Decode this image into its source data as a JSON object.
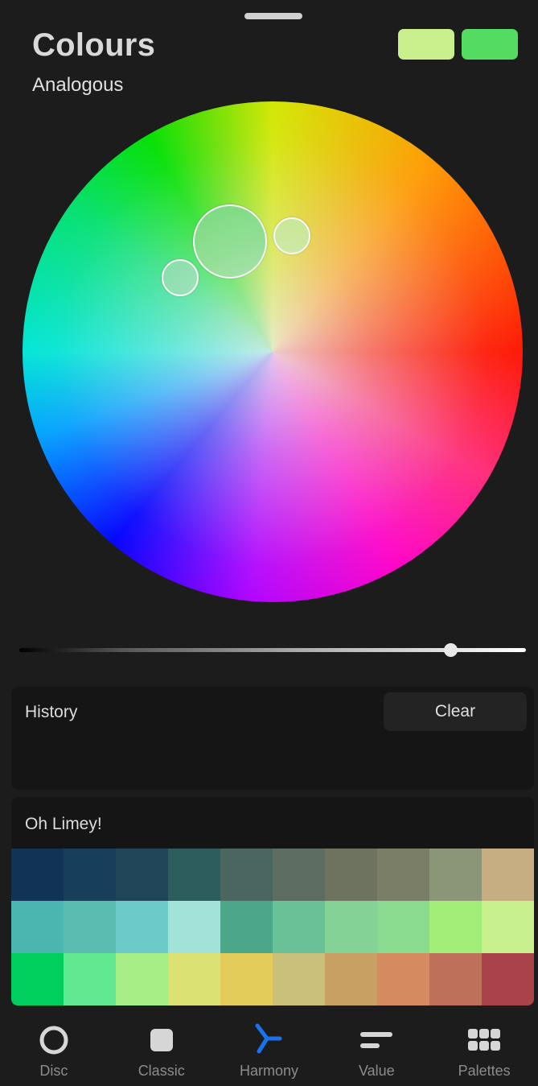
{
  "header": {
    "title": "Colours",
    "mode": "Analogous",
    "swatches": {
      "secondary": "#c9f08c",
      "primary": "#54db61"
    }
  },
  "wheel": {
    "selected_color": "#55d65c",
    "harmony_colors": [
      "#b7e56c",
      "#5cd88e"
    ]
  },
  "brightness": {
    "value": 0.85
  },
  "history": {
    "label": "History",
    "clear_label": "Clear"
  },
  "palette": {
    "name": "Oh Limey!",
    "rows": [
      [
        "#113354",
        "#153f5b",
        "#214558",
        "#2c5c5c",
        "#4b6660",
        "#5e6d62",
        "#6e735f",
        "#7b7e66",
        "#8b9679",
        "#c7ad82"
      ],
      [
        "#4bb5b0",
        "#5bbcb2",
        "#6ccac9",
        "#a1e3d9",
        "#4ca68a",
        "#69c198",
        "#85d297",
        "#8adb90",
        "#a3ee79",
        "#c8f08e"
      ],
      [
        "#00cf5d",
        "#63e892",
        "#a6ed84",
        "#dbe273",
        "#e3cc59",
        "#cbc07b",
        "#c8a063",
        "#d48b5f",
        "#bd705a",
        "#a94349"
      ]
    ]
  },
  "tabs": [
    {
      "label": "Disc",
      "icon": "circle-outline-icon"
    },
    {
      "label": "Classic",
      "icon": "rounded-square-icon"
    },
    {
      "label": "Harmony",
      "icon": "harmony-icon",
      "active": true
    },
    {
      "label": "Value",
      "icon": "sliders-icon"
    },
    {
      "label": "Palettes",
      "icon": "grid-icon"
    }
  ],
  "colors": {
    "accent": "#1a72f0",
    "icon": "#d6d6d6",
    "tab_label": "#8c8c8c"
  }
}
